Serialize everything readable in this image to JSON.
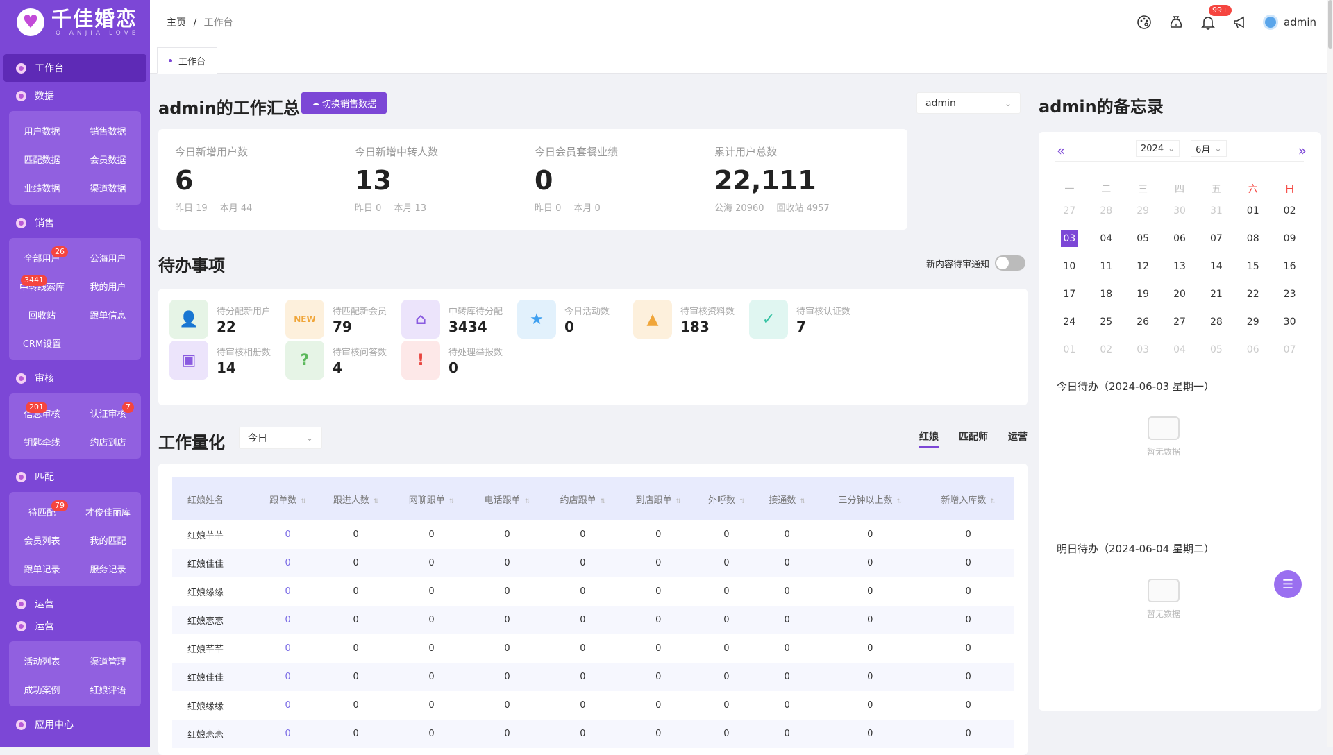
{
  "logo": {
    "title": "千佳婚恋",
    "subtitle": "QIANJIA LOVE"
  },
  "sidebar": {
    "home": "工作台",
    "sections": [
      {
        "title": "数据",
        "items": [
          {
            "label": "用户数据"
          },
          {
            "label": "销售数据"
          },
          {
            "label": "匹配数据"
          },
          {
            "label": "会员数据"
          },
          {
            "label": "业绩数据"
          },
          {
            "label": "渠道数据"
          }
        ]
      },
      {
        "title": "销售",
        "items": [
          {
            "label": "全部用户",
            "badge": "26"
          },
          {
            "label": "公海用户"
          },
          {
            "label": "中转线索库",
            "badge": "3441"
          },
          {
            "label": "我的用户"
          },
          {
            "label": "回收站"
          },
          {
            "label": "跟单信息"
          },
          {
            "label": "CRM设置"
          }
        ]
      },
      {
        "title": "审核",
        "items": [
          {
            "label": "信息审核",
            "badge": "201"
          },
          {
            "label": "认证审核",
            "badge": "7"
          },
          {
            "label": "钥匙牵线"
          },
          {
            "label": "约店到店"
          }
        ]
      },
      {
        "title": "匹配",
        "items": [
          {
            "label": "待匹配",
            "badge": "79"
          },
          {
            "label": "才俊佳丽库"
          },
          {
            "label": "会员列表"
          },
          {
            "label": "我的匹配"
          },
          {
            "label": "跟单记录"
          },
          {
            "label": "服务记录"
          }
        ]
      }
    ],
    "ops1": "运营",
    "ops2": "运营",
    "ops_items": [
      {
        "label": "活动列表"
      },
      {
        "label": "渠道管理"
      },
      {
        "label": "成功案例"
      },
      {
        "label": "红娘评语"
      }
    ],
    "app_center": "应用中心"
  },
  "header": {
    "home": "主页",
    "sep": "/",
    "current": "工作台",
    "notify_badge": "99+",
    "user": "admin"
  },
  "tab": {
    "label": "工作台"
  },
  "summary": {
    "title": "admin的工作汇总",
    "switch_btn": "切换销售数据",
    "select_value": "admin",
    "cards": [
      {
        "label": "今日新增用户数",
        "value": "6",
        "sub1": "昨日 19",
        "sub2": "本月 44"
      },
      {
        "label": "今日新增中转人数",
        "value": "13",
        "sub1": "昨日 0",
        "sub2": "本月 13"
      },
      {
        "label": "今日会员套餐业绩",
        "value": "0",
        "sub1": "昨日 0",
        "sub2": "本月 0"
      },
      {
        "label": "累计用户总数",
        "value": "22,111",
        "sub1": "公海 20960",
        "sub2": "回收站 4957"
      }
    ]
  },
  "todo": {
    "title": "待办事项",
    "toggle_label": "新内容待审通知",
    "items": [
      {
        "label": "待分配新用户",
        "value": "22",
        "color": "#e6f4e6",
        "fg": "#5bb85b",
        "icon": "user-add-icon"
      },
      {
        "label": "待匹配新会员",
        "value": "79",
        "color": "#fdf0dc",
        "fg": "#f0a63a",
        "icon": "crown-new-icon"
      },
      {
        "label": "中转库待分配",
        "value": "3434",
        "color": "#ece4fb",
        "fg": "#8a5be0",
        "icon": "house-icon"
      },
      {
        "label": "今日活动数",
        "value": "0",
        "color": "#e2f1fc",
        "fg": "#3fa0f0",
        "icon": "bookmark-star-icon"
      },
      {
        "label": "待审核资料数",
        "value": "183",
        "color": "#fdf0dc",
        "fg": "#f0a63a",
        "icon": "stamp-icon"
      },
      {
        "label": "待审核认证数",
        "value": "7",
        "color": "#e0f6f1",
        "fg": "#34c2a2",
        "icon": "verified-icon"
      },
      {
        "label": "待审核相册数",
        "value": "14",
        "color": "#ece4fb",
        "fg": "#8a5be0",
        "icon": "photo-icon"
      },
      {
        "label": "待审核问答数",
        "value": "4",
        "color": "#e6f4e6",
        "fg": "#5bb85b",
        "icon": "question-chat-icon"
      },
      {
        "label": "待处理举报数",
        "value": "0",
        "color": "#fde8e8",
        "fg": "#e8453f",
        "icon": "warning-icon"
      }
    ]
  },
  "workload": {
    "title": "工作量化",
    "period": "今日",
    "roles": [
      "红娘",
      "匹配师",
      "运营"
    ],
    "columns": [
      "红娘姓名",
      "跟单数",
      "跟进人数",
      "网聊跟单",
      "电话跟单",
      "约店跟单",
      "到店跟单",
      "外呼数",
      "接通数",
      "三分钟以上数",
      "新增入库数"
    ],
    "rows": [
      [
        "红娘芊芊",
        "0",
        "0",
        "0",
        "0",
        "0",
        "0",
        "0",
        "0",
        "0",
        "0"
      ],
      [
        "红娘佳佳",
        "0",
        "0",
        "0",
        "0",
        "0",
        "0",
        "0",
        "0",
        "0",
        "0"
      ],
      [
        "红娘缘缘",
        "0",
        "0",
        "0",
        "0",
        "0",
        "0",
        "0",
        "0",
        "0",
        "0"
      ],
      [
        "红娘恋恋",
        "0",
        "0",
        "0",
        "0",
        "0",
        "0",
        "0",
        "0",
        "0",
        "0"
      ],
      [
        "红娘芊芊",
        "0",
        "0",
        "0",
        "0",
        "0",
        "0",
        "0",
        "0",
        "0",
        "0"
      ],
      [
        "红娘佳佳",
        "0",
        "0",
        "0",
        "0",
        "0",
        "0",
        "0",
        "0",
        "0",
        "0"
      ],
      [
        "红娘缘缘",
        "0",
        "0",
        "0",
        "0",
        "0",
        "0",
        "0",
        "0",
        "0",
        "0"
      ],
      [
        "红娘恋恋",
        "0",
        "0",
        "0",
        "0",
        "0",
        "0",
        "0",
        "0",
        "0",
        "0"
      ]
    ]
  },
  "memo": {
    "title": "admin的备忘录",
    "year": "2024",
    "month": "6月",
    "weekdays": [
      "一",
      "二",
      "三",
      "四",
      "五",
      "六",
      "日"
    ],
    "days": [
      [
        "27",
        "gray"
      ],
      [
        "28",
        "gray"
      ],
      [
        "29",
        "gray"
      ],
      [
        "30",
        "gray"
      ],
      [
        "31",
        "gray"
      ],
      [
        "01",
        ""
      ],
      [
        "02",
        ""
      ],
      [
        "03",
        "today"
      ],
      [
        "04",
        ""
      ],
      [
        "05",
        ""
      ],
      [
        "06",
        ""
      ],
      [
        "07",
        ""
      ],
      [
        "08",
        ""
      ],
      [
        "09",
        ""
      ],
      [
        "10",
        ""
      ],
      [
        "11",
        ""
      ],
      [
        "12",
        ""
      ],
      [
        "13",
        ""
      ],
      [
        "14",
        ""
      ],
      [
        "15",
        ""
      ],
      [
        "16",
        ""
      ],
      [
        "17",
        ""
      ],
      [
        "18",
        ""
      ],
      [
        "19",
        ""
      ],
      [
        "20",
        ""
      ],
      [
        "21",
        ""
      ],
      [
        "22",
        ""
      ],
      [
        "23",
        ""
      ],
      [
        "24",
        ""
      ],
      [
        "25",
        ""
      ],
      [
        "26",
        ""
      ],
      [
        "27",
        ""
      ],
      [
        "28",
        ""
      ],
      [
        "29",
        ""
      ],
      [
        "30",
        ""
      ],
      [
        "01",
        "gray"
      ],
      [
        "02",
        "gray"
      ],
      [
        "03",
        "gray"
      ],
      [
        "04",
        "gray"
      ],
      [
        "05",
        "gray"
      ],
      [
        "06",
        "gray"
      ],
      [
        "07",
        "gray"
      ]
    ],
    "today_label": "今日待办（2024-06-03 星期一）",
    "tomorrow_label": "明日待办（2024-06-04 星期二）",
    "empty": "暂无数据"
  }
}
